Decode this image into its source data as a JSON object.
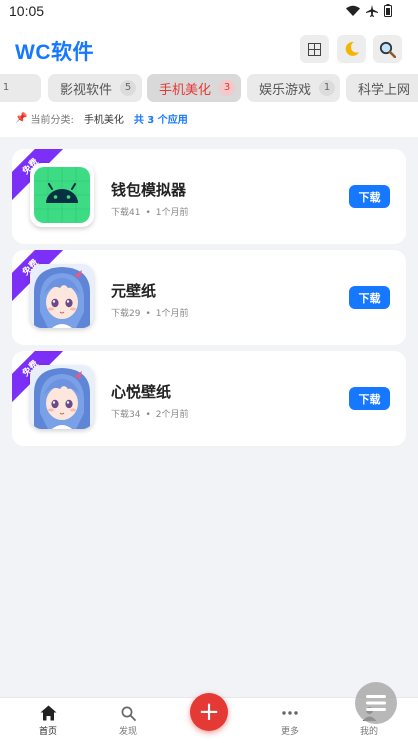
{
  "status_bar": {
    "time": "10:05",
    "icons": [
      "wifi-icon",
      "airplane-icon",
      "battery-icon"
    ]
  },
  "header": {
    "title": "WC软件",
    "buttons": [
      "grid-icon",
      "moon-icon",
      "search-icon"
    ]
  },
  "tabs": [
    {
      "label": "",
      "count": "1",
      "active": false
    },
    {
      "label": "影视软件",
      "count": "5",
      "active": false
    },
    {
      "label": "手机美化",
      "count": "3",
      "active": true
    },
    {
      "label": "娱乐游戏",
      "count": "1",
      "active": false
    },
    {
      "label": "科学上网",
      "count": "",
      "active": false
    }
  ],
  "category_info": {
    "prefix": "当前分类:",
    "selected": "手机美化",
    "count_text": "共 3 个应用"
  },
  "apps": [
    {
      "badge": "免费",
      "name": "钱包模拟器",
      "downloads": "下载41",
      "time": "1个月前",
      "button": "下载",
      "icon": "android-icon"
    },
    {
      "badge": "免费",
      "name": "元壁纸",
      "downloads": "下载29",
      "time": "1个月前",
      "button": "下载",
      "icon": "anime-avatar-icon"
    },
    {
      "badge": "免费",
      "name": "心悦壁纸",
      "downloads": "下载34",
      "time": "2个月前",
      "button": "下载",
      "icon": "anime-avatar-icon"
    }
  ],
  "bottom_nav": [
    {
      "label": "首页",
      "icon": "home-icon",
      "active": true
    },
    {
      "label": "发现",
      "icon": "search-icon",
      "active": false
    },
    {
      "label": "更多",
      "icon": "more-icon",
      "active": false
    },
    {
      "label": "我的",
      "icon": "user-icon",
      "active": false
    }
  ],
  "fab_label": "+",
  "colors": {
    "accent": "#1677ff",
    "active_tab": "#e53935",
    "badge": "#7b2ff7",
    "fab": "#e53935"
  }
}
